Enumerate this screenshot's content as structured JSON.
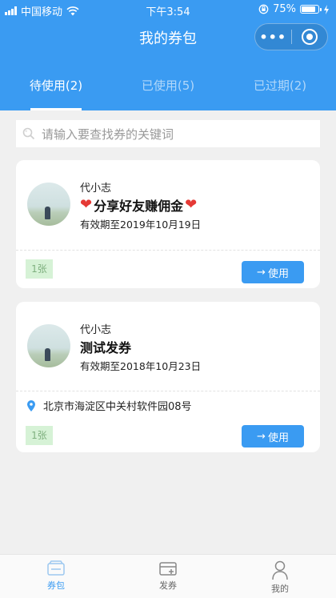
{
  "status_bar": {
    "carrier": "中国移动",
    "time": "下午3:54",
    "battery": "75%",
    "battery_level": 0.75,
    "icons": [
      "signal-icon",
      "wifi-icon",
      "rotation-lock-icon",
      "battery-icon",
      "charging-icon"
    ]
  },
  "nav": {
    "title": "我的券包",
    "more_icon": "more-dots-icon",
    "close_icon": "target-close-icon"
  },
  "tabs": [
    {
      "label": "待使用(2)",
      "active": true
    },
    {
      "label": "已使用(5)",
      "active": false
    },
    {
      "label": "已过期(2)",
      "active": false
    }
  ],
  "search": {
    "placeholder": "请输入要查找券的关键词",
    "icon": "search-icon"
  },
  "coupons": [
    {
      "name": "代小志",
      "title": "分享好友赚佣金",
      "expire": "有效期至2019年10月19日",
      "quantity": "1张",
      "use_label": "使用",
      "has_hearts": true
    },
    {
      "name": "代小志",
      "title": "测试发券",
      "expire": "有效期至2018年10月23日",
      "location": "北京市海淀区中关村软件园08号",
      "quantity": "1张",
      "use_label": "使用"
    }
  ],
  "tabbar": [
    {
      "label": "券包",
      "icon": "coupon-wallet-icon",
      "active": true
    },
    {
      "label": "发券",
      "icon": "issue-coupon-icon",
      "active": false
    },
    {
      "label": "我的",
      "icon": "user-profile-icon",
      "active": false
    }
  ],
  "colors": {
    "primary": "#3a9bf2",
    "background": "#f0f0f0",
    "quantity_badge": "#d6f2d6",
    "heart": "#e53935"
  }
}
